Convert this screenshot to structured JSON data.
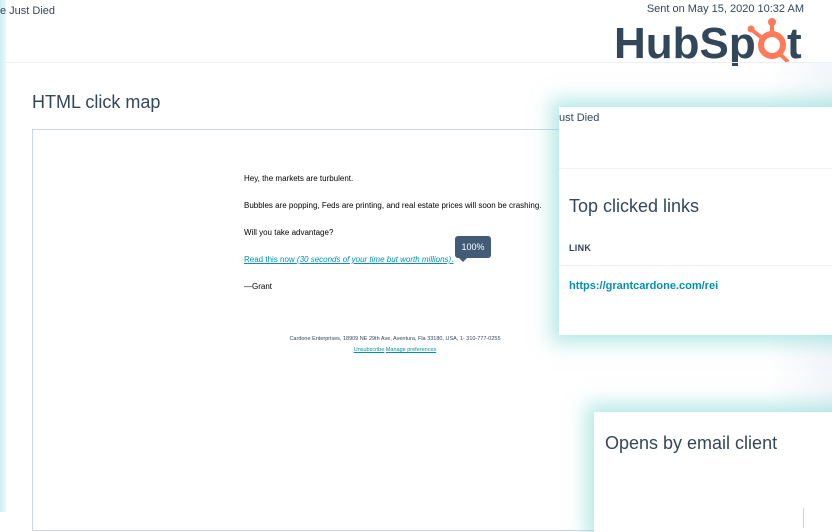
{
  "header": {
    "subject_fragment": "e Just Died",
    "sent_on": "Sent on May 15, 2020 10:32 AM",
    "logo_text": "HubSpot",
    "logo_icon": "hubspot-sprocket-icon"
  },
  "click_map": {
    "title": "HTML click map",
    "email": {
      "line1": "Hey, the markets are turbulent.",
      "line2": "Bubbles are popping, Feds are printing, and real estate prices will soon be crashing.",
      "line3": "Will you take advantage?",
      "link_prefix": "Read this now ",
      "link_italic": "(30 seconds of your time but worth millions)",
      "link_suffix": ".",
      "signature": "—Grant",
      "address": "Cardone Enterprises, 18909 NE 29th Ave, Aventura, Fla 33180, USA, 1- 310-777-0255",
      "unsubscribe": "Unsubscribe",
      "manage": "Manage preferences"
    },
    "tooltip": "100%"
  },
  "top_links_panel": {
    "subject_fragment": "ust Died",
    "title": "Top clicked links",
    "column_header": "LINK",
    "links": [
      "https://grantcardone.com/rei"
    ]
  },
  "opens_panel": {
    "title": "Opens by email client"
  },
  "colors": {
    "brand": "#ff7a59",
    "text": "#33475b",
    "link": "#0091ae",
    "glow": "#78d7d2"
  }
}
